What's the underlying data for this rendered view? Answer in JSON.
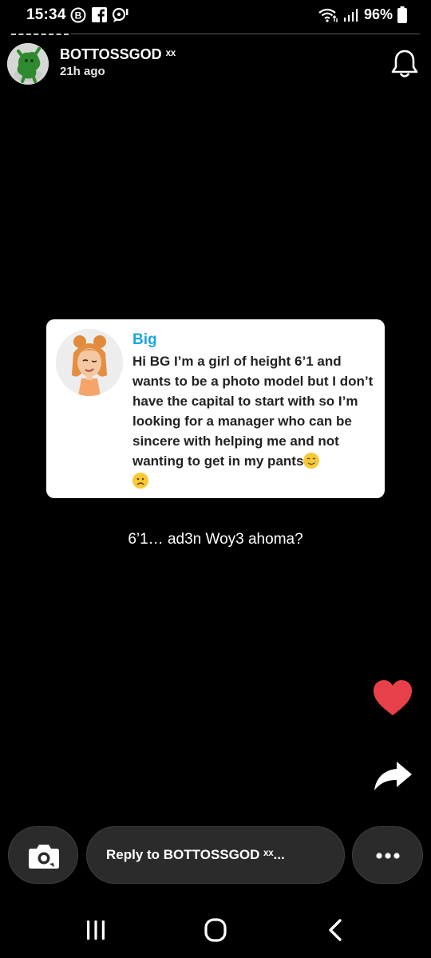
{
  "status_bar": {
    "time": "15:34",
    "notification_icons": [
      "b-circle-icon",
      "facebook-icon",
      "chat-bubble-icon"
    ],
    "battery_percent": "96%",
    "right_icons": [
      "wifi-icon",
      "signal-icon",
      "battery-icon"
    ]
  },
  "story": {
    "progress": 0.14,
    "username": "BOTTOSSGOD",
    "username_suffix": "ˣˣ",
    "time_ago": "21h ago"
  },
  "question_card": {
    "sender_name": "Big",
    "message_main": "Hi BG I’m a girl of height 6’1 and wants to be a photo model but I don’t have the capital to start with so I’m looking for a manager who can be sincere with helping me and not wanting to get in my pants",
    "emojis": [
      "smiling-tear-face-emoji",
      "frowning-face-emoji"
    ]
  },
  "caption": "6’1… ad3n Woy3 ahoma?",
  "actions": {
    "reply_placeholder": "Reply to BOTTOSSGOD ˣˣ...",
    "colors": {
      "heart": "#e8404a",
      "accent_name": "#1aa6dd"
    }
  }
}
